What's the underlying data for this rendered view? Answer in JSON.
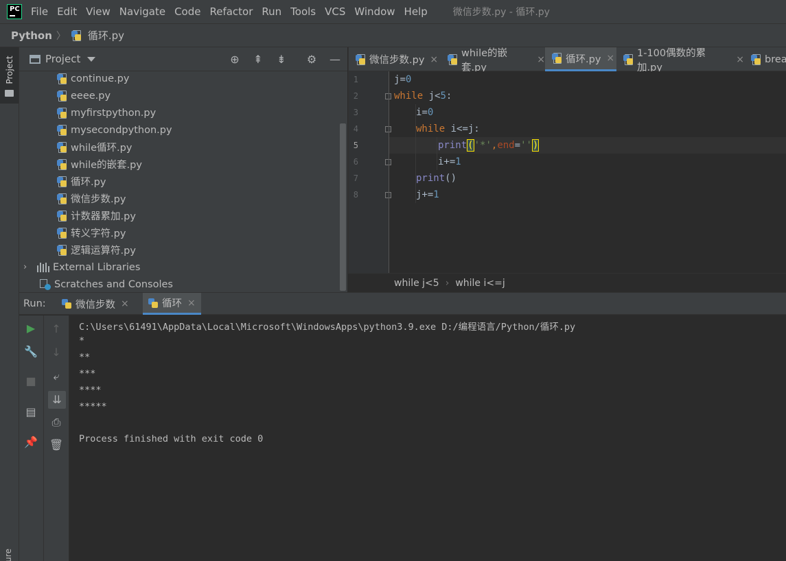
{
  "menu": {
    "app_logo": "PC",
    "items": [
      "File",
      "Edit",
      "View",
      "Navigate",
      "Code",
      "Refactor",
      "Run",
      "Tools",
      "VCS",
      "Window",
      "Help"
    ],
    "window_title": "微信步数.py - 循环.py"
  },
  "navbar": {
    "root": "Python",
    "file": "循环.py"
  },
  "left_strip": {
    "project": "Project",
    "structure": "cture"
  },
  "project_panel": {
    "title": "Project",
    "files": [
      "continue.py",
      "eeee.py",
      "myfirstpython.py",
      "mysecondpython.py",
      "while循环.py",
      "while的嵌套.py",
      "循环.py",
      "微信步数.py",
      "计数器累加.py",
      "转义字符.py",
      "逻辑运算符.py"
    ],
    "external_libraries": "External Libraries",
    "scratches": "Scratches and Consoles"
  },
  "editor": {
    "tabs": [
      {
        "label": "微信步数.py",
        "close": "×"
      },
      {
        "label": "while的嵌套.py",
        "close": "×"
      },
      {
        "label": "循环.py",
        "close": "×",
        "active": true
      },
      {
        "label": "1-100偶数的累加.py",
        "close": "×"
      },
      {
        "label": "breal"
      }
    ],
    "line_numbers": [
      "1",
      "2",
      "3",
      "4",
      "5",
      "6",
      "7",
      "8"
    ],
    "current_line": 5,
    "code": {
      "l1_var": "j",
      "l1_op": "=",
      "l1_num": "0",
      "l2_kw": "while",
      "l2_cond": " j<",
      "l2_num": "5",
      "l2_colon": ":",
      "l3_var": "i",
      "l3_op": "=",
      "l3_num": "0",
      "l4_kw": "while",
      "l4_cond": " i<=j:",
      "l5_fn": "print",
      "l5_open": "(",
      "l5_str1": "'*'",
      "l5_comma": ",",
      "l5_kw": "end",
      "l5_eq": "=",
      "l5_str2": "''",
      "l5_close": ")",
      "l6_text": "i+=",
      "l6_num": "1",
      "l7_fn": "print",
      "l7_paren": "()",
      "l8_text": "j+=",
      "l8_num": "1"
    },
    "breadcrumb": [
      "while j<5",
      "while i<=j"
    ]
  },
  "run_panel": {
    "label": "Run:",
    "tabs": [
      {
        "label": "微信步数",
        "close": "×"
      },
      {
        "label": "循环",
        "close": "×",
        "active": true
      }
    ],
    "output": [
      "C:\\Users\\61491\\AppData\\Local\\Microsoft\\WindowsApps\\python3.9.exe D:/编程语言/Python/循环.py",
      "*",
      "**",
      "***",
      "****",
      "*****",
      "Process finished with exit code 0"
    ]
  },
  "colors": {
    "background": "#2b2b2b",
    "panel": "#3c3f41",
    "keyword": "#cc7832",
    "number": "#6897bb",
    "string": "#6a8759",
    "accent": "#4a88c7",
    "run_green": "#499c54"
  },
  "icons": [
    "locate-icon",
    "expand-all-icon",
    "collapse-all-icon",
    "gear-icon",
    "minimize-icon",
    "run-icon",
    "wrench-icon",
    "stop-icon",
    "layout-icon",
    "pin-icon",
    "up-arrow-icon",
    "down-arrow-icon",
    "soft-wrap-icon",
    "scroll-to-end-icon",
    "print-icon",
    "trash-icon"
  ]
}
